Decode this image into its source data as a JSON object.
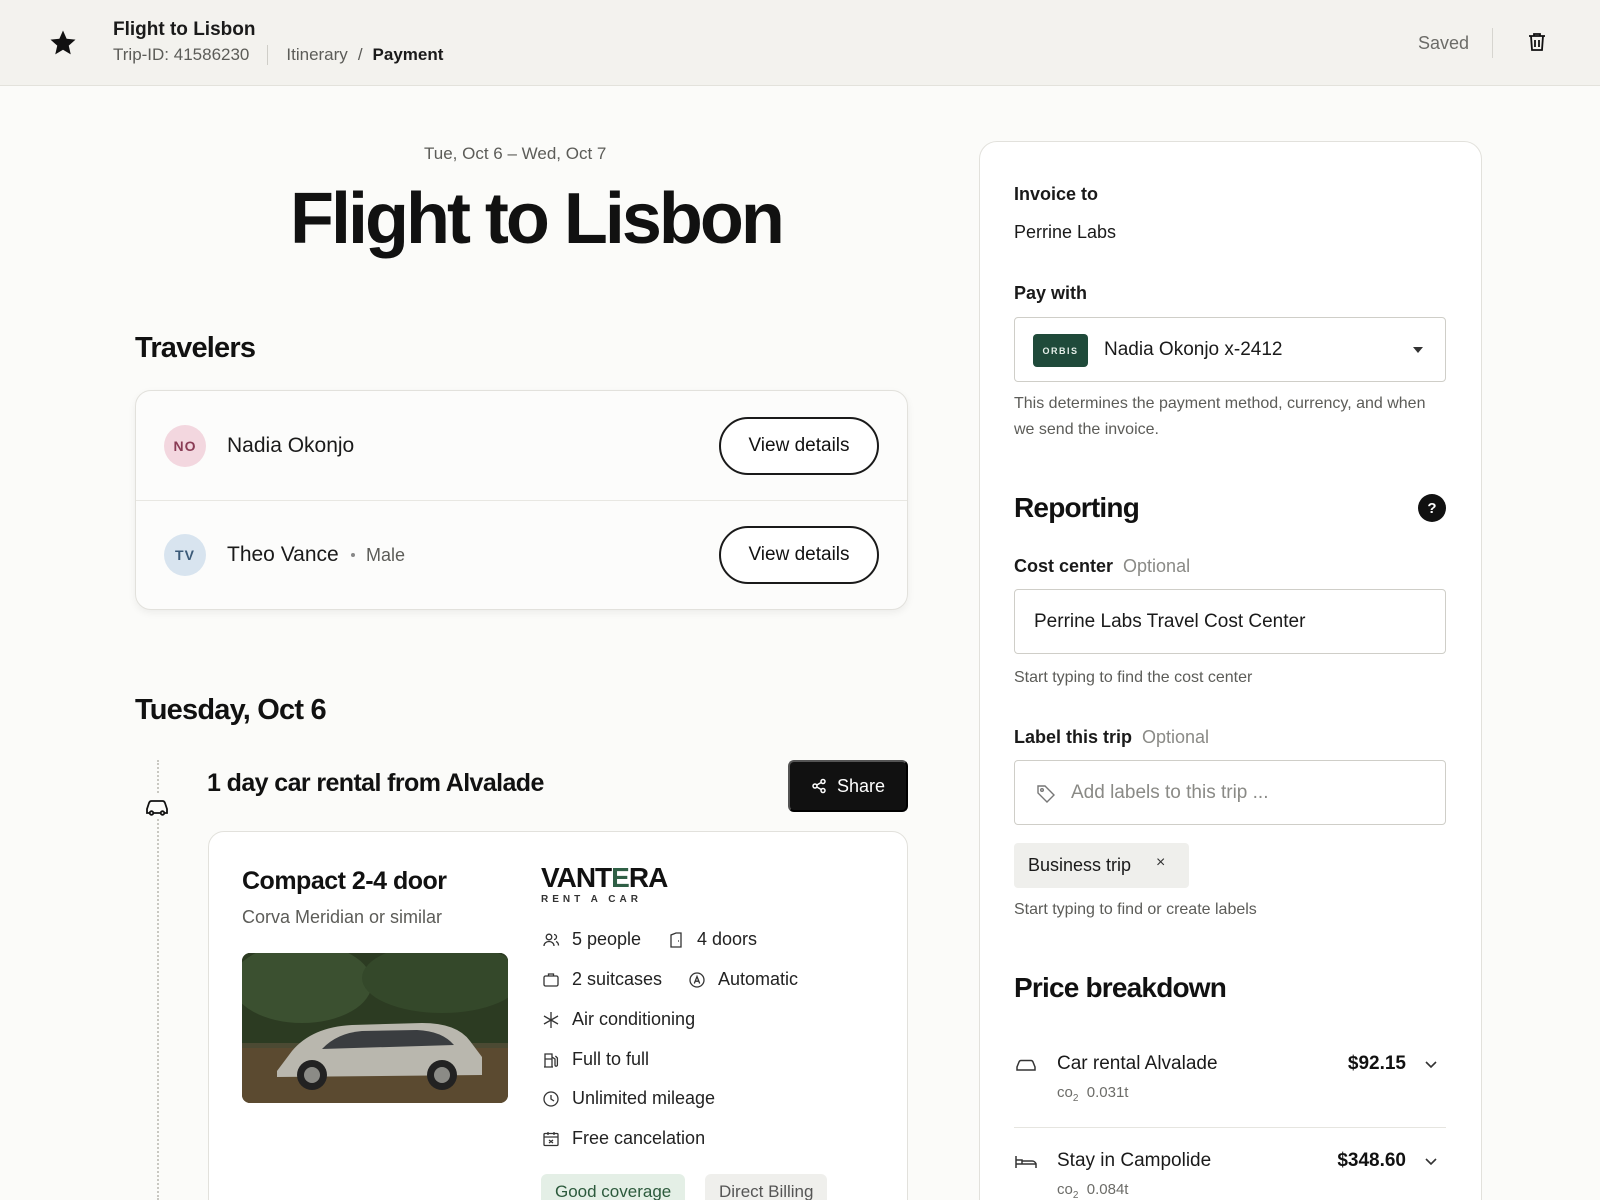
{
  "topbar": {
    "title": "Flight to Lisbon",
    "trip_id": "Trip-ID: 41586230",
    "crumb_itinerary": "Itinerary",
    "crumb_separator": "/",
    "crumb_payment": "Payment",
    "saved": "Saved",
    "icons": [
      "star-icon",
      "trash-icon"
    ]
  },
  "header": {
    "dates": "Tue, Oct 6 – Wed, Oct 7",
    "title": "Flight to Lisbon"
  },
  "travelers": {
    "heading": "Travelers",
    "list": [
      {
        "initials": "NO",
        "name": "Nadia Okonjo",
        "gender": "",
        "button": "View details"
      },
      {
        "initials": "TV",
        "name": "Theo Vance",
        "gender": "Male",
        "button": "View details"
      }
    ]
  },
  "day": {
    "heading": "Tuesday, Oct 6",
    "event_title": "1 day car rental from Alvalade",
    "share_label": "Share",
    "car": {
      "class": "Compact 2-4 door",
      "model": "Corva Meridian or similar",
      "brand_pre": "VANT",
      "brand_accent": "E",
      "brand_post": "RA",
      "brand_sub": "RENT A CAR",
      "features": {
        "people": "5 people",
        "doors": "4 doors",
        "suitcases": "2 suitcases",
        "transmission": "Automatic",
        "ac": "Air conditioning",
        "fuel": "Full to full",
        "mileage": "Unlimited mileage",
        "cancel": "Free cancelation"
      },
      "badges": [
        "Good coverage",
        "Direct Billing"
      ]
    }
  },
  "panel": {
    "invoice_label": "Invoice to",
    "invoice_value": "Perrine Labs",
    "pay_label": "Pay with",
    "pay_card_brand": "ORBIS",
    "pay_value": "Nadia Okonjo x-2412",
    "pay_help": "This determines the payment method, currency, and when we send the invoice.",
    "reporting_heading": "Reporting",
    "help_glyph": "?",
    "cost_center_label": "Cost center",
    "optional": "Optional",
    "cost_center_value": "Perrine Labs Travel Cost Center",
    "cost_center_help": "Start typing to find the cost center",
    "label_trip_label": "Label this trip",
    "label_placeholder": "Add labels to this trip ...",
    "chip_label": "Business trip",
    "chip_remove": "×",
    "label_help": "Start typing to find or create labels",
    "price_heading": "Price breakdown",
    "co2_prefix": "co",
    "co2_sub": "2",
    "prices": [
      {
        "name": "Car rental Alvalade",
        "amount": "$92.15",
        "co2": "0.031t",
        "icon": "car-icon"
      },
      {
        "name": "Stay in Campolide",
        "amount": "$348.60",
        "co2": "0.084t",
        "icon": "bed-icon"
      }
    ]
  },
  "colors": {
    "accent_dark": "#111111",
    "card_brand_green": "#1f4a3a",
    "badge_green_bg": "#e4efe6",
    "avatar_no_bg": "#f3d7df",
    "avatar_tv_bg": "#d8e4ef"
  }
}
